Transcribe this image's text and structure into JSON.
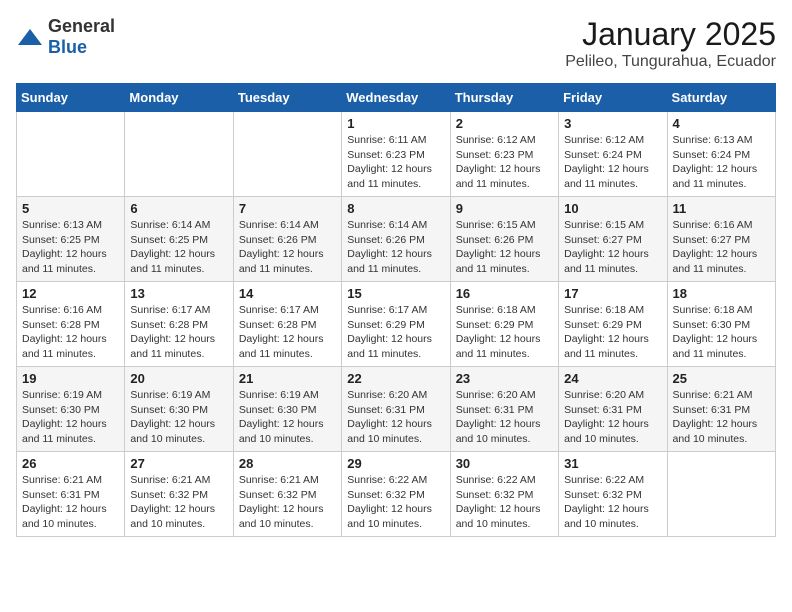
{
  "logo": {
    "general": "General",
    "blue": "Blue"
  },
  "header": {
    "month": "January 2025",
    "location": "Pelileo, Tungurahua, Ecuador"
  },
  "weekdays": [
    "Sunday",
    "Monday",
    "Tuesday",
    "Wednesday",
    "Thursday",
    "Friday",
    "Saturday"
  ],
  "weeks": [
    [
      {
        "day": "",
        "sunrise": "",
        "sunset": "",
        "daylight": ""
      },
      {
        "day": "",
        "sunrise": "",
        "sunset": "",
        "daylight": ""
      },
      {
        "day": "",
        "sunrise": "",
        "sunset": "",
        "daylight": ""
      },
      {
        "day": "1",
        "sunrise": "Sunrise: 6:11 AM",
        "sunset": "Sunset: 6:23 PM",
        "daylight": "Daylight: 12 hours and 11 minutes."
      },
      {
        "day": "2",
        "sunrise": "Sunrise: 6:12 AM",
        "sunset": "Sunset: 6:23 PM",
        "daylight": "Daylight: 12 hours and 11 minutes."
      },
      {
        "day": "3",
        "sunrise": "Sunrise: 6:12 AM",
        "sunset": "Sunset: 6:24 PM",
        "daylight": "Daylight: 12 hours and 11 minutes."
      },
      {
        "day": "4",
        "sunrise": "Sunrise: 6:13 AM",
        "sunset": "Sunset: 6:24 PM",
        "daylight": "Daylight: 12 hours and 11 minutes."
      }
    ],
    [
      {
        "day": "5",
        "sunrise": "Sunrise: 6:13 AM",
        "sunset": "Sunset: 6:25 PM",
        "daylight": "Daylight: 12 hours and 11 minutes."
      },
      {
        "day": "6",
        "sunrise": "Sunrise: 6:14 AM",
        "sunset": "Sunset: 6:25 PM",
        "daylight": "Daylight: 12 hours and 11 minutes."
      },
      {
        "day": "7",
        "sunrise": "Sunrise: 6:14 AM",
        "sunset": "Sunset: 6:26 PM",
        "daylight": "Daylight: 12 hours and 11 minutes."
      },
      {
        "day": "8",
        "sunrise": "Sunrise: 6:14 AM",
        "sunset": "Sunset: 6:26 PM",
        "daylight": "Daylight: 12 hours and 11 minutes."
      },
      {
        "day": "9",
        "sunrise": "Sunrise: 6:15 AM",
        "sunset": "Sunset: 6:26 PM",
        "daylight": "Daylight: 12 hours and 11 minutes."
      },
      {
        "day": "10",
        "sunrise": "Sunrise: 6:15 AM",
        "sunset": "Sunset: 6:27 PM",
        "daylight": "Daylight: 12 hours and 11 minutes."
      },
      {
        "day": "11",
        "sunrise": "Sunrise: 6:16 AM",
        "sunset": "Sunset: 6:27 PM",
        "daylight": "Daylight: 12 hours and 11 minutes."
      }
    ],
    [
      {
        "day": "12",
        "sunrise": "Sunrise: 6:16 AM",
        "sunset": "Sunset: 6:28 PM",
        "daylight": "Daylight: 12 hours and 11 minutes."
      },
      {
        "day": "13",
        "sunrise": "Sunrise: 6:17 AM",
        "sunset": "Sunset: 6:28 PM",
        "daylight": "Daylight: 12 hours and 11 minutes."
      },
      {
        "day": "14",
        "sunrise": "Sunrise: 6:17 AM",
        "sunset": "Sunset: 6:28 PM",
        "daylight": "Daylight: 12 hours and 11 minutes."
      },
      {
        "day": "15",
        "sunrise": "Sunrise: 6:17 AM",
        "sunset": "Sunset: 6:29 PM",
        "daylight": "Daylight: 12 hours and 11 minutes."
      },
      {
        "day": "16",
        "sunrise": "Sunrise: 6:18 AM",
        "sunset": "Sunset: 6:29 PM",
        "daylight": "Daylight: 12 hours and 11 minutes."
      },
      {
        "day": "17",
        "sunrise": "Sunrise: 6:18 AM",
        "sunset": "Sunset: 6:29 PM",
        "daylight": "Daylight: 12 hours and 11 minutes."
      },
      {
        "day": "18",
        "sunrise": "Sunrise: 6:18 AM",
        "sunset": "Sunset: 6:30 PM",
        "daylight": "Daylight: 12 hours and 11 minutes."
      }
    ],
    [
      {
        "day": "19",
        "sunrise": "Sunrise: 6:19 AM",
        "sunset": "Sunset: 6:30 PM",
        "daylight": "Daylight: 12 hours and 11 minutes."
      },
      {
        "day": "20",
        "sunrise": "Sunrise: 6:19 AM",
        "sunset": "Sunset: 6:30 PM",
        "daylight": "Daylight: 12 hours and 10 minutes."
      },
      {
        "day": "21",
        "sunrise": "Sunrise: 6:19 AM",
        "sunset": "Sunset: 6:30 PM",
        "daylight": "Daylight: 12 hours and 10 minutes."
      },
      {
        "day": "22",
        "sunrise": "Sunrise: 6:20 AM",
        "sunset": "Sunset: 6:31 PM",
        "daylight": "Daylight: 12 hours and 10 minutes."
      },
      {
        "day": "23",
        "sunrise": "Sunrise: 6:20 AM",
        "sunset": "Sunset: 6:31 PM",
        "daylight": "Daylight: 12 hours and 10 minutes."
      },
      {
        "day": "24",
        "sunrise": "Sunrise: 6:20 AM",
        "sunset": "Sunset: 6:31 PM",
        "daylight": "Daylight: 12 hours and 10 minutes."
      },
      {
        "day": "25",
        "sunrise": "Sunrise: 6:21 AM",
        "sunset": "Sunset: 6:31 PM",
        "daylight": "Daylight: 12 hours and 10 minutes."
      }
    ],
    [
      {
        "day": "26",
        "sunrise": "Sunrise: 6:21 AM",
        "sunset": "Sunset: 6:31 PM",
        "daylight": "Daylight: 12 hours and 10 minutes."
      },
      {
        "day": "27",
        "sunrise": "Sunrise: 6:21 AM",
        "sunset": "Sunset: 6:32 PM",
        "daylight": "Daylight: 12 hours and 10 minutes."
      },
      {
        "day": "28",
        "sunrise": "Sunrise: 6:21 AM",
        "sunset": "Sunset: 6:32 PM",
        "daylight": "Daylight: 12 hours and 10 minutes."
      },
      {
        "day": "29",
        "sunrise": "Sunrise: 6:22 AM",
        "sunset": "Sunset: 6:32 PM",
        "daylight": "Daylight: 12 hours and 10 minutes."
      },
      {
        "day": "30",
        "sunrise": "Sunrise: 6:22 AM",
        "sunset": "Sunset: 6:32 PM",
        "daylight": "Daylight: 12 hours and 10 minutes."
      },
      {
        "day": "31",
        "sunrise": "Sunrise: 6:22 AM",
        "sunset": "Sunset: 6:32 PM",
        "daylight": "Daylight: 12 hours and 10 minutes."
      },
      {
        "day": "",
        "sunrise": "",
        "sunset": "",
        "daylight": ""
      }
    ]
  ]
}
